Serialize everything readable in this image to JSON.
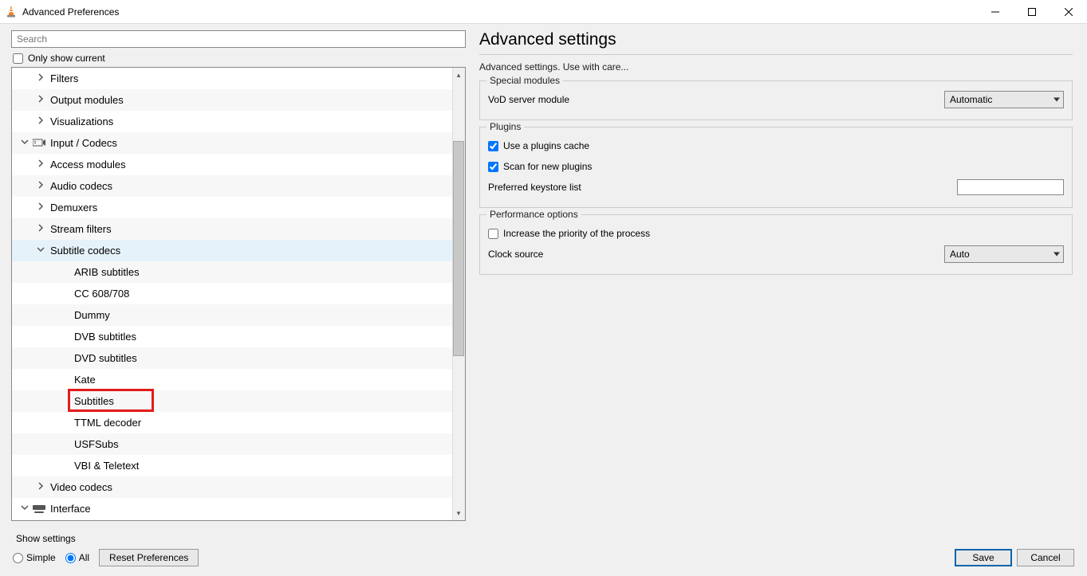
{
  "window": {
    "title": "Advanced Preferences"
  },
  "left": {
    "search_placeholder": "Search",
    "only_show_current_label": "Only show current"
  },
  "tree": {
    "items": [
      {
        "label": "Filters",
        "depth": 2,
        "expander": "right",
        "icon": null
      },
      {
        "label": "Output modules",
        "depth": 2,
        "expander": "right",
        "icon": null
      },
      {
        "label": "Visualizations",
        "depth": 2,
        "expander": "right",
        "icon": null
      },
      {
        "label": "Input / Codecs",
        "depth": 1,
        "expander": "down",
        "icon": "input-codecs"
      },
      {
        "label": "Access modules",
        "depth": 2,
        "expander": "right",
        "icon": null
      },
      {
        "label": "Audio codecs",
        "depth": 2,
        "expander": "right",
        "icon": null
      },
      {
        "label": "Demuxers",
        "depth": 2,
        "expander": "right",
        "icon": null
      },
      {
        "label": "Stream filters",
        "depth": 2,
        "expander": "right",
        "icon": null
      },
      {
        "label": "Subtitle codecs",
        "depth": 2,
        "expander": "down",
        "icon": null,
        "selected": true
      },
      {
        "label": "ARIB subtitles",
        "depth": 3,
        "expander": null,
        "icon": null
      },
      {
        "label": "CC 608/708",
        "depth": 3,
        "expander": null,
        "icon": null
      },
      {
        "label": "Dummy",
        "depth": 3,
        "expander": null,
        "icon": null
      },
      {
        "label": "DVB subtitles",
        "depth": 3,
        "expander": null,
        "icon": null
      },
      {
        "label": "DVD subtitles",
        "depth": 3,
        "expander": null,
        "icon": null
      },
      {
        "label": "Kate",
        "depth": 3,
        "expander": null,
        "icon": null
      },
      {
        "label": "Subtitles",
        "depth": 3,
        "expander": null,
        "icon": null,
        "highlight": true
      },
      {
        "label": "TTML decoder",
        "depth": 3,
        "expander": null,
        "icon": null
      },
      {
        "label": "USFSubs",
        "depth": 3,
        "expander": null,
        "icon": null
      },
      {
        "label": "VBI & Teletext",
        "depth": 3,
        "expander": null,
        "icon": null
      },
      {
        "label": "Video codecs",
        "depth": 2,
        "expander": "right",
        "icon": null
      },
      {
        "label": "Interface",
        "depth": 1,
        "expander": "down",
        "icon": "interface"
      }
    ]
  },
  "right": {
    "title": "Advanced settings",
    "subtitle": "Advanced settings. Use with care...",
    "group1": {
      "legend": "Special modules",
      "vod_label": "VoD server module",
      "vod_value": "Automatic"
    },
    "group2": {
      "legend": "Plugins",
      "use_cache_label": "Use a plugins cache",
      "scan_label": "Scan for new plugins",
      "keystore_label": "Preferred keystore list",
      "keystore_value": ""
    },
    "group3": {
      "legend": "Performance options",
      "priority_label": "Increase the priority of the process",
      "clock_label": "Clock source",
      "clock_value": "Auto"
    }
  },
  "footer": {
    "show_settings_label": "Show settings",
    "simple_label": "Simple",
    "all_label": "All",
    "reset_label": "Reset Preferences",
    "save_label": "Save",
    "cancel_label": "Cancel"
  }
}
